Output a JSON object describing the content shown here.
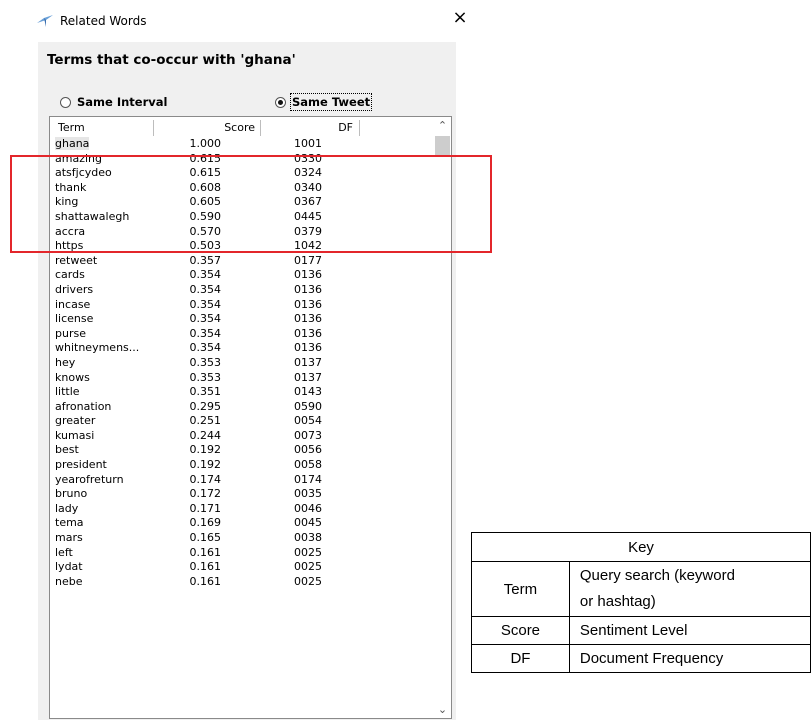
{
  "dialog": {
    "title": "Related Words",
    "close_glyph": "×",
    "heading": "Terms that co-occur with 'ghana'",
    "options": [
      "Same Interval",
      "Same Tweet"
    ],
    "selected_option": "Same Tweet"
  },
  "table": {
    "columns": [
      "Term",
      "Score",
      "DF"
    ],
    "rows": [
      [
        "ghana",
        "1.000",
        "1001"
      ],
      [
        "amazing",
        "0.615",
        "0330"
      ],
      [
        "atsfjcydeo",
        "0.615",
        "0324"
      ],
      [
        "thank",
        "0.608",
        "0340"
      ],
      [
        "king",
        "0.605",
        "0367"
      ],
      [
        "shattawalegh",
        "0.590",
        "0445"
      ],
      [
        "accra",
        "0.570",
        "0379"
      ],
      [
        "https",
        "0.503",
        "1042"
      ],
      [
        "retweet",
        "0.357",
        "0177"
      ],
      [
        "cards",
        "0.354",
        "0136"
      ],
      [
        "drivers",
        "0.354",
        "0136"
      ],
      [
        "incase",
        "0.354",
        "0136"
      ],
      [
        "license",
        "0.354",
        "0136"
      ],
      [
        "purse",
        "0.354",
        "0136"
      ],
      [
        "whitneymens...",
        "0.354",
        "0136"
      ],
      [
        "hey",
        "0.353",
        "0137"
      ],
      [
        "knows",
        "0.353",
        "0137"
      ],
      [
        "little",
        "0.351",
        "0143"
      ],
      [
        "afronation",
        "0.295",
        "0590"
      ],
      [
        "greater",
        "0.251",
        "0054"
      ],
      [
        "kumasi",
        "0.244",
        "0073"
      ],
      [
        "best",
        "0.192",
        "0056"
      ],
      [
        "president",
        "0.192",
        "0058"
      ],
      [
        "yearofreturn",
        "0.174",
        "0174"
      ],
      [
        "bruno",
        "0.172",
        "0035"
      ],
      [
        "lady",
        "0.171",
        "0046"
      ],
      [
        "tema",
        "0.169",
        "0045"
      ],
      [
        "mars",
        "0.165",
        "0038"
      ],
      [
        "left",
        "0.161",
        "0025"
      ],
      [
        "lydat",
        "0.161",
        "0025"
      ],
      [
        "nebe",
        "0.161",
        "0025"
      ]
    ],
    "highlighted_rows": [
      "amazing",
      "atsfjcydeo",
      "thank",
      "king",
      "shattawalegh"
    ],
    "highlight_color": "#e3262b"
  },
  "key": {
    "title": "Key",
    "rows": [
      {
        "term": "Term",
        "desc_lines": [
          "Query search (keyword",
          "or hashtag)"
        ]
      },
      {
        "term": "Score",
        "desc_lines": [
          "Sentiment Level"
        ]
      },
      {
        "term": "DF",
        "desc_lines": [
          "Document Frequency"
        ]
      }
    ]
  },
  "icons": [
    "app-icon",
    "close-icon",
    "scroll-up-icon",
    "scroll-down-icon"
  ]
}
